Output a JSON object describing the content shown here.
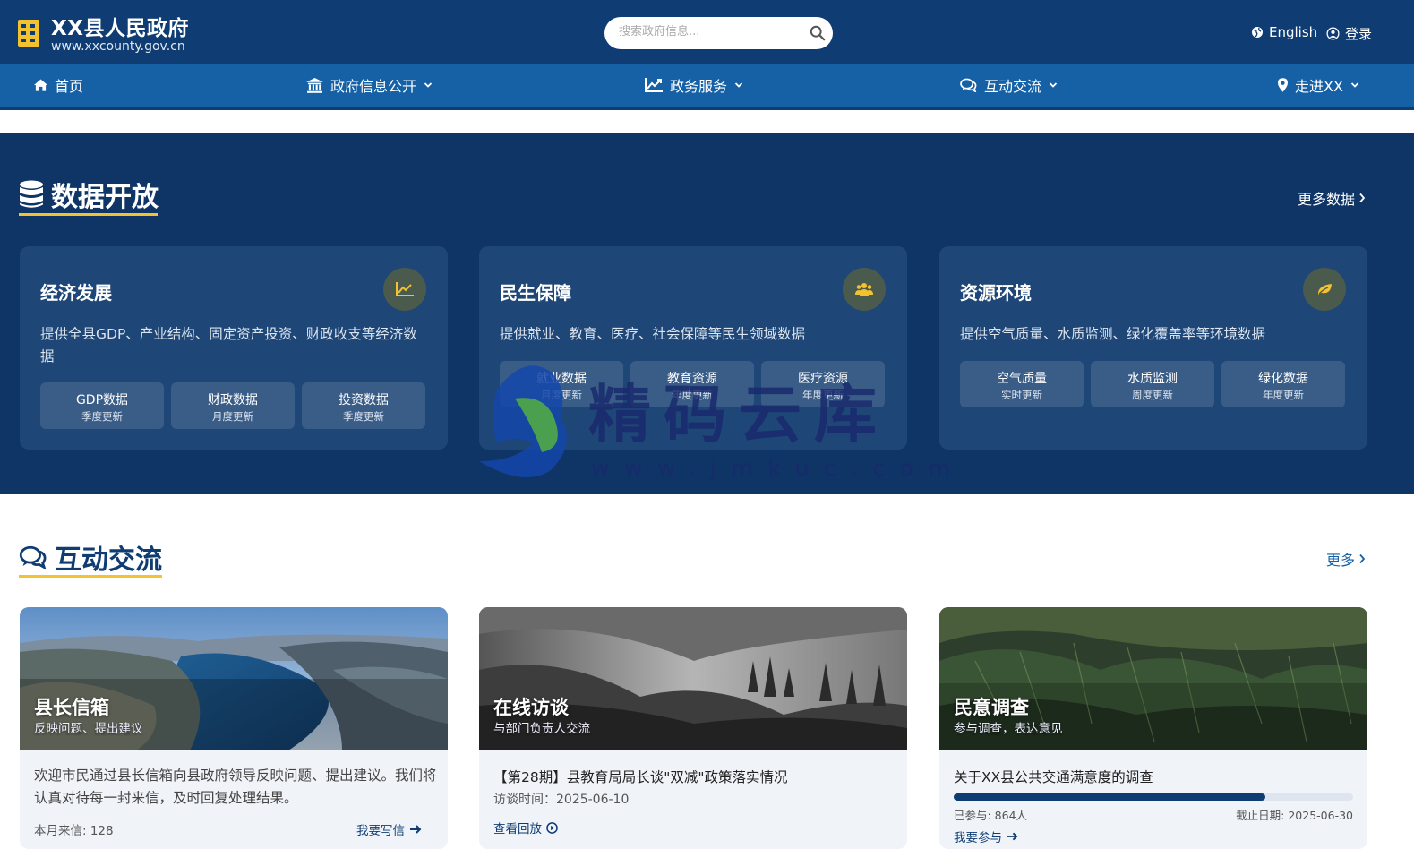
{
  "header": {
    "title": "XX县人民政府",
    "url": "www.xxcounty.gov.cn",
    "search_placeholder": "搜索政府信息...",
    "english_label": "English",
    "login_label": "登录"
  },
  "nav": {
    "items": [
      {
        "label": "首页",
        "icon": "home-icon"
      },
      {
        "label": "政府信息公开",
        "icon": "bank-icon"
      },
      {
        "label": "政务服务",
        "icon": "chart-line-icon"
      },
      {
        "label": "互动交流",
        "icon": "comments-icon"
      },
      {
        "label": "走进XX",
        "icon": "map-pin-icon"
      }
    ]
  },
  "data_section": {
    "title": "数据开放",
    "more_label": "更多数据",
    "cards": [
      {
        "title": "经济发展",
        "icon": "chart-line-icon",
        "desc": "提供全县GDP、产业结构、固定资产投资、财政收支等经济数据",
        "chips": [
          {
            "name": "GDP数据",
            "freq": "季度更新"
          },
          {
            "name": "财政数据",
            "freq": "月度更新"
          },
          {
            "name": "投资数据",
            "freq": "季度更新"
          }
        ]
      },
      {
        "title": "民生保障",
        "icon": "users-icon",
        "desc": "提供就业、教育、医疗、社会保障等民生领域数据",
        "chips": [
          {
            "name": "就业数据",
            "freq": "月度更新"
          },
          {
            "name": "教育资源",
            "freq": "年度更新"
          },
          {
            "name": "医疗资源",
            "freq": "年度更新"
          }
        ]
      },
      {
        "title": "资源环境",
        "icon": "leaf-icon",
        "desc": "提供空气质量、水质监测、绿化覆盖率等环境数据",
        "chips": [
          {
            "name": "空气质量",
            "freq": "实时更新"
          },
          {
            "name": "水质监测",
            "freq": "周度更新"
          },
          {
            "name": "绿化数据",
            "freq": "年度更新"
          }
        ]
      }
    ]
  },
  "watermark": {
    "text": "精码云库",
    "url": "www.jmkuc.com"
  },
  "interaction": {
    "title": "互动交流",
    "more_label": "更多",
    "cards": [
      {
        "title": "县长信箱",
        "subtitle": "反映问题、提出建议",
        "text": "欢迎市民通过县长信箱向县政府领导反映问题、提出建议。我们将认真对待每一封来信，及时回复处理结果。",
        "stat": "本月来信: 128",
        "action": "我要写信"
      },
      {
        "title": "在线访谈",
        "subtitle": "与部门负责人交流",
        "headline": "【第28期】县教育局局长谈\"双减\"政策落实情况",
        "time": "访谈时间：2025-06-10",
        "action": "查看回放"
      },
      {
        "title": "民意调查",
        "subtitle": "参与调查，表达意见",
        "headline": "关于XX县公共交通满意度的调查",
        "progress": 0.78,
        "participants": "已参与: 864人",
        "deadline": "截止日期: 2025-06-30",
        "action": "我要参与"
      }
    ]
  },
  "colors": {
    "header_bg": "#0e3c73",
    "nav_bg": "#1661a6",
    "section_bg": "#0f3466",
    "card_bg": "#1e4676",
    "accent": "#f2c230"
  }
}
